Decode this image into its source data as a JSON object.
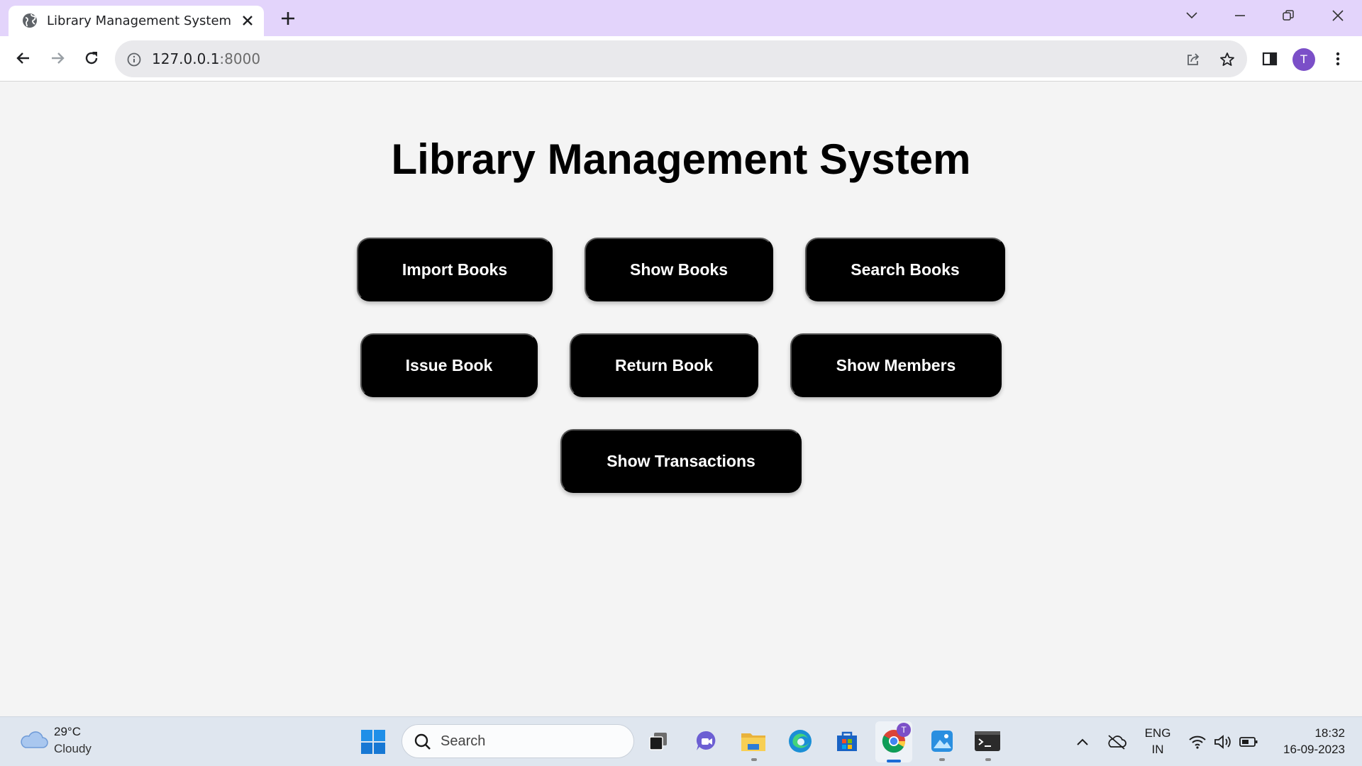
{
  "browser": {
    "tab_title": "Library Management System",
    "url_host": "127.0.0.1",
    "url_port": ":8000",
    "profile_initial": "T",
    "tab_bar_color": "#e3d4fb"
  },
  "page": {
    "title": "Library Management System",
    "buttons": {
      "import_books": "Import Books",
      "show_books": "Show Books",
      "search_books": "Search Books",
      "issue_book": "Issue Book",
      "return_book": "Return Book",
      "show_members": "Show Members",
      "show_transactions": "Show Transactions"
    },
    "button_color": "#000000"
  },
  "taskbar": {
    "weather_temp": "29°C",
    "weather_desc": "Cloudy",
    "search_placeholder": "Search",
    "lang_line1": "ENG",
    "lang_line2": "IN",
    "time": "18:32",
    "date": "16-09-2023",
    "chrome_badge": "T"
  }
}
